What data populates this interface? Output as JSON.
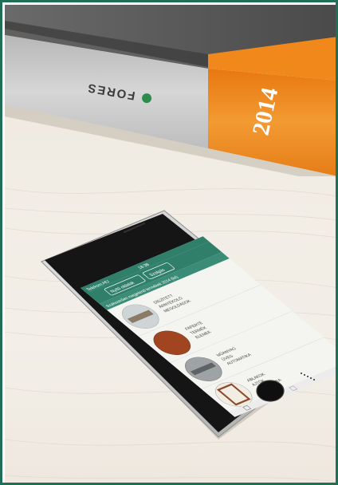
{
  "book": {
    "brand": "FORES",
    "year": "2014",
    "colors": {
      "orange": "#f08a1e",
      "silver": "#c9c9c9",
      "dark": "#5a5a5a"
    }
  },
  "phone": {
    "status_left": "Telekom.HU",
    "status_time": "18:38",
    "tabs": [
      "Nyitó oldalak",
      "Szolgás"
    ],
    "header": "Szakszerűen megjelenő termékek 2014 (fel)",
    "items": [
      {
        "lines": [
          "DÍSZÍTETT",
          "ÁRNYÉKOLÓ",
          "MEGOLDÁSOK"
        ],
        "icon": "cylinder-roll-icon"
      },
      {
        "lines": [
          "FAFERTÉ",
          "TERMÉK",
          "ELEMEK"
        ],
        "icon": "wood-plank-icon"
      },
      {
        "lines": [
          "MŰANYAG",
          "ÜVEG",
          "AUTOMATIKA"
        ],
        "icon": "hinge-rail-icon"
      },
      {
        "lines": [
          "ABLAKOK",
          "AJTÓK",
          "AUTOMATIKA"
        ],
        "icon": "door-frame-icon"
      }
    ],
    "colors": {
      "teal": "#2f7f6a",
      "screen_bg": "#f4f4f1"
    }
  }
}
